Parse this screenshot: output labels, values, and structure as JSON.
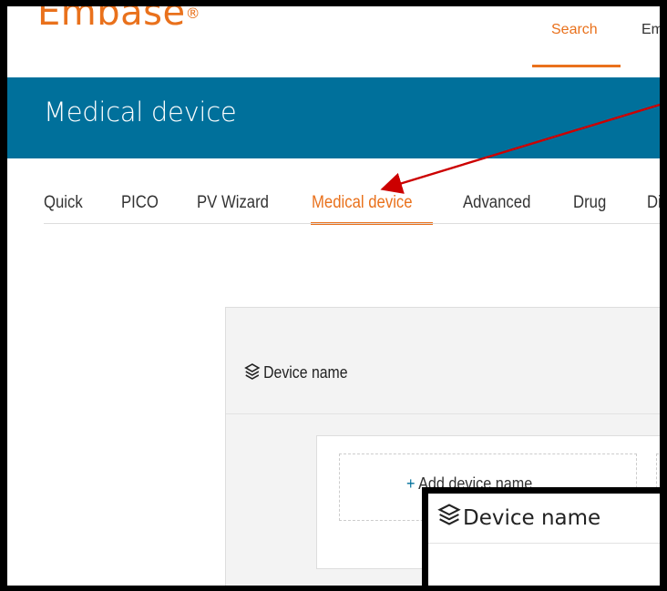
{
  "header": {
    "logo_text": "Embase",
    "logo_mark": "®",
    "nav_items": [
      {
        "label": "Search",
        "active": true
      },
      {
        "label": "Em",
        "active": false
      }
    ]
  },
  "banner": {
    "title": "Medical device"
  },
  "tabs": [
    {
      "label": "Quick",
      "active": false
    },
    {
      "label": "PICO",
      "active": false
    },
    {
      "label": "PV Wizard",
      "active": false
    },
    {
      "label": "Medical device",
      "active": true
    },
    {
      "label": "Advanced",
      "active": false
    },
    {
      "label": "Drug",
      "active": false
    },
    {
      "label": "Di",
      "active": false
    }
  ],
  "panel": {
    "heading": "Device name",
    "add_button": "Add device name",
    "add_button_prefix": "+"
  },
  "inset": {
    "heading": "Device name"
  },
  "colors": {
    "accent": "#e9711c",
    "banner": "#00709b",
    "arrow": "#cc0000"
  }
}
